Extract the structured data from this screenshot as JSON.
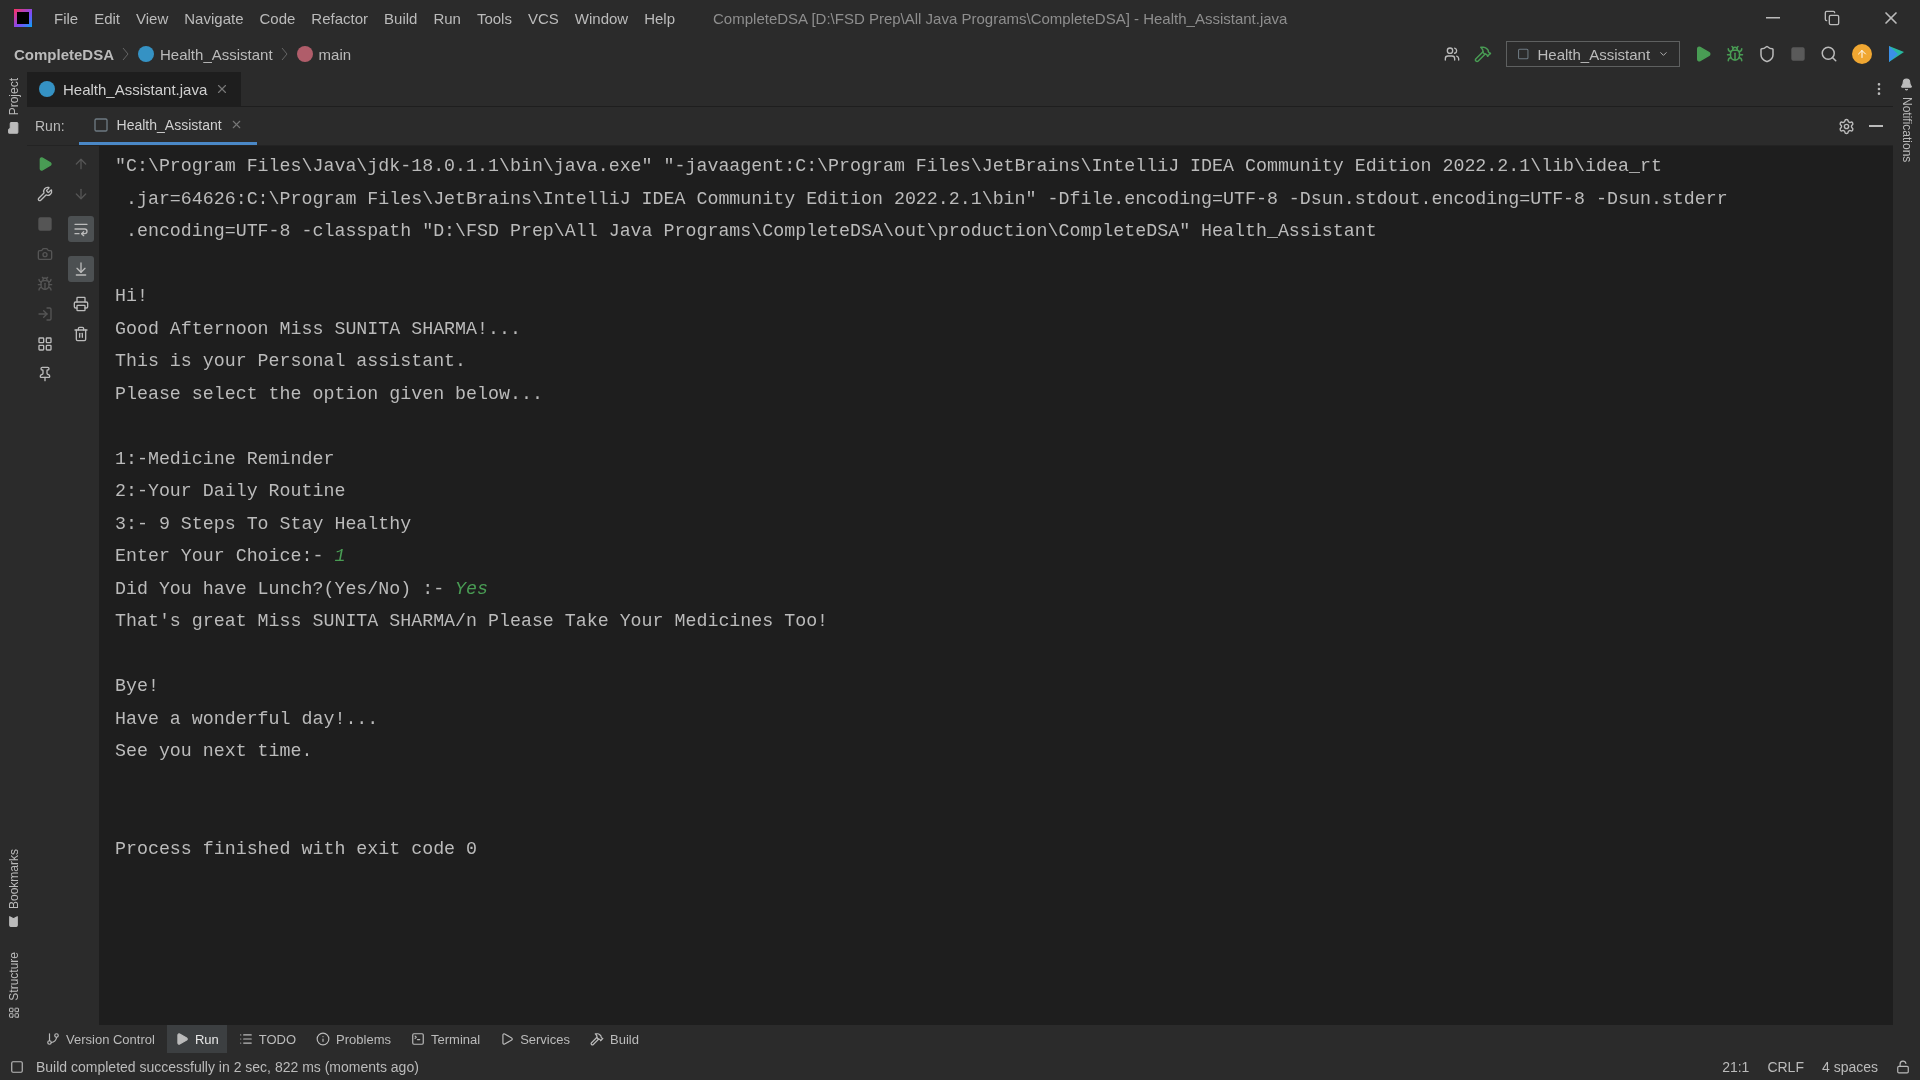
{
  "menu": [
    "File",
    "Edit",
    "View",
    "Navigate",
    "Code",
    "Refactor",
    "Build",
    "Run",
    "Tools",
    "VCS",
    "Window",
    "Help"
  ],
  "window": {
    "title": "CompleteDSA [D:\\FSD Prep\\All Java Programs\\CompleteDSA] - Health_Assistant.java"
  },
  "breadcrumbs": [
    {
      "kind": "project",
      "label": "CompleteDSA"
    },
    {
      "kind": "class",
      "label": "Health_Assistant"
    },
    {
      "kind": "method",
      "label": "main"
    }
  ],
  "run_config": {
    "label": "Health_Assistant"
  },
  "editor_tabs": [
    {
      "label": "Health_Assistant.java",
      "selected": true
    }
  ],
  "left_strip": {
    "top": [
      "Project"
    ],
    "bottom": [
      "Bookmarks",
      "Structure"
    ]
  },
  "right_strip": [
    "Notifications"
  ],
  "run_panel": {
    "label": "Run:",
    "tabs": [
      {
        "label": "Health_Assistant",
        "selected": true
      }
    ]
  },
  "console": [
    {
      "kind": "text",
      "text": "\"C:\\Program Files\\Java\\jdk-18.0.1.1\\bin\\java.exe\" \"-javaagent:C:\\Program Files\\JetBrains\\IntelliJ IDEA Community Edition 2022.2.1\\lib\\idea_rt"
    },
    {
      "kind": "text",
      "text": " .jar=64626:C:\\Program Files\\JetBrains\\IntelliJ IDEA Community Edition 2022.2.1\\bin\" -Dfile.encoding=UTF-8 -Dsun.stdout.encoding=UTF-8 -Dsun.stderr"
    },
    {
      "kind": "text",
      "text": " .encoding=UTF-8 -classpath \"D:\\FSD Prep\\All Java Programs\\CompleteDSA\\out\\production\\CompleteDSA\" Health_Assistant"
    },
    {
      "kind": "blank"
    },
    {
      "kind": "text",
      "text": "Hi!"
    },
    {
      "kind": "text",
      "text": "Good Afternoon Miss SUNITA SHARMA!..."
    },
    {
      "kind": "text",
      "text": "This is your Personal assistant."
    },
    {
      "kind": "text",
      "text": "Please select the option given below..."
    },
    {
      "kind": "blank"
    },
    {
      "kind": "text",
      "text": "1:-Medicine Reminder"
    },
    {
      "kind": "text",
      "text": "2:-Your Daily Routine"
    },
    {
      "kind": "text",
      "text": "3:- 9 Steps To Stay Healthy"
    },
    {
      "kind": "text",
      "text": "Enter Your Choice:- ",
      "input": "1"
    },
    {
      "kind": "text",
      "text": "Did You have Lunch?(Yes/No) :- ",
      "input": "Yes"
    },
    {
      "kind": "text",
      "text": "That's great Miss SUNITA SHARMA/n Please Take Your Medicines Too!"
    },
    {
      "kind": "blank"
    },
    {
      "kind": "text",
      "text": "Bye!"
    },
    {
      "kind": "text",
      "text": "Have a wonderful day!..."
    },
    {
      "kind": "text",
      "text": "See you next time."
    },
    {
      "kind": "blank"
    },
    {
      "kind": "blank"
    },
    {
      "kind": "text",
      "text": "Process finished with exit code 0"
    }
  ],
  "tool_tabs": [
    {
      "kind": "vcs",
      "label": "Version Control",
      "selected": false
    },
    {
      "kind": "run",
      "label": "Run",
      "selected": true
    },
    {
      "kind": "todo",
      "label": "TODO",
      "selected": false
    },
    {
      "kind": "problems",
      "label": "Problems",
      "selected": false
    },
    {
      "kind": "terminal",
      "label": "Terminal",
      "selected": false
    },
    {
      "kind": "services",
      "label": "Services",
      "selected": false
    },
    {
      "kind": "build",
      "label": "Build",
      "selected": false
    }
  ],
  "status_bar": {
    "message": "Build completed successfully in 2 sec, 822 ms (moments ago)",
    "items": [
      "21:1",
      "CRLF",
      "4 spaces"
    ]
  }
}
